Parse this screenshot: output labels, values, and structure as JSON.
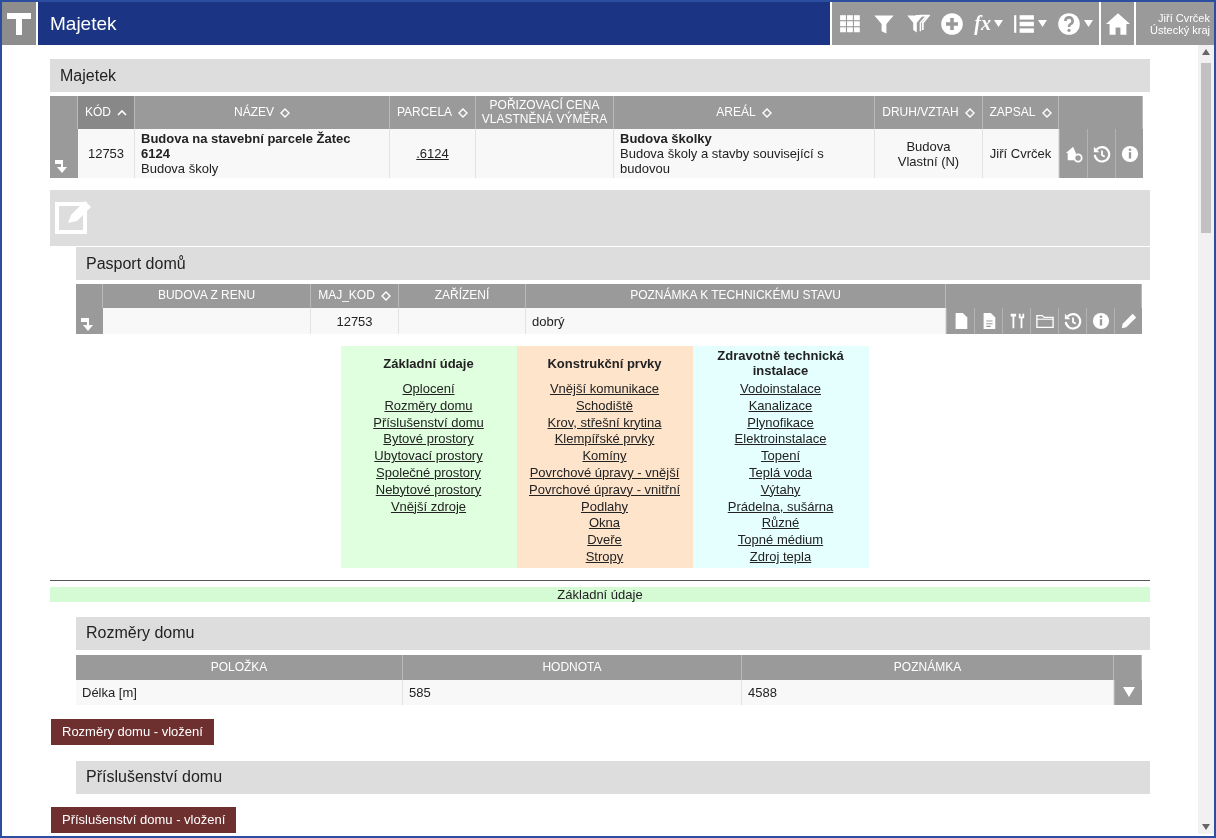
{
  "header": {
    "title": "Majetek",
    "function_label": "fx",
    "user_name": "Jiří Cvrček",
    "user_region": "Ústecký kraj"
  },
  "majetek": {
    "title": "Majetek",
    "columns": [
      {
        "label": "KÓD",
        "sortable": true,
        "sorted": true
      },
      {
        "label": "NÁZEV",
        "sortable": true,
        "sorted": false
      },
      {
        "label": "PARCELA",
        "sortable": true,
        "sorted": false
      },
      {
        "label": "POŘIZOVACÍ CENA VLASTNĚNÁ VÝMĚRA",
        "sortable": false,
        "sorted": false
      },
      {
        "label": "AREÁL",
        "sortable": true,
        "sorted": false
      },
      {
        "label": "DRUH/VZTAH",
        "sortable": true,
        "sorted": false
      },
      {
        "label": "ZAPSAL",
        "sortable": true,
        "sorted": false
      }
    ],
    "row": {
      "kod": "12753",
      "nazev": "Budova na stavební parcele Žatec 6124",
      "nazev_sub": "Budova školy",
      "parcela": ".6124",
      "areal": "Budova školky",
      "areal_sub": "Budova školy a stavby související s budovou",
      "druh": "Budova",
      "vztah": "Vlastní (N)",
      "zapsal": "Jiří Cvrček"
    }
  },
  "pasport": {
    "title": "Pasport domů",
    "columns": [
      {
        "label": "BUDOVA Z RENU",
        "sortable": false
      },
      {
        "label": "MAJ_KOD",
        "sortable": true
      },
      {
        "label": "ZAŘÍZENÍ",
        "sortable": false
      },
      {
        "label": "POZNÁMKA K TECHNICKÉMU STAVU",
        "sortable": false
      }
    ],
    "row": {
      "maj_kod": "12753",
      "poznamka": "dobrý"
    }
  },
  "menu": [
    {
      "title": "Základní údaje",
      "color": "#dfffdf",
      "items": [
        "Oplocení",
        "Rozměry domu",
        "Příslušenství domu",
        "Bytové prostory",
        "Ubytovací prostory",
        "Společné prostory",
        "Nebytové prostory",
        "Vnější zdroje"
      ]
    },
    {
      "title": "Konstrukční prvky",
      "color": "#ffe4cc",
      "items": [
        "Vnější komunikace",
        "Schodiště",
        "Krov, střešní krytina",
        "Klempířské prvky",
        "Komíny",
        "Povrchové úpravy - vnější",
        "Povrchové úpravy - vnitřní",
        "Podlahy",
        "Okna",
        "Dveře",
        "Stropy"
      ]
    },
    {
      "title": "Zdravotně technická instalace",
      "color": "#e5ffff",
      "items": [
        "Vodoinstalace",
        "Kanalizace",
        "Plynofikace",
        "Elektroinstalace",
        "Topení",
        "Teplá voda",
        "Výtahy",
        "Prádelna, sušárna",
        "Různé",
        "Topné médium",
        "Zdroj tepla"
      ]
    }
  ],
  "active_section": "Základní údaje",
  "rozmery": {
    "title": "Rozměry domu",
    "columns": [
      "POLOŽKA",
      "HODNOTA",
      "POZNÁMKA"
    ],
    "row": [
      "Délka [m]",
      "585",
      "4588"
    ],
    "button": "Rozměry domu - vložení"
  },
  "prislusenstvi": {
    "title": "Příslušenství domu",
    "button": "Příslušenství domu - vložení"
  }
}
